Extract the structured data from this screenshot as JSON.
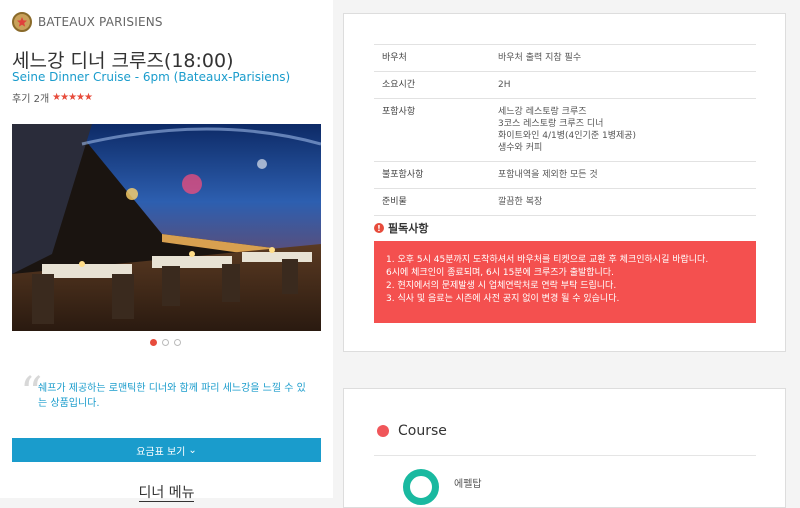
{
  "header": {
    "brand": "BATEAUX PARISIENS",
    "title": "세느강 디너 크루즈(18:00)",
    "subtitle": "Seine Dinner Cruise - 6pm (Bateaux-Parisiens)",
    "review_label": "후기 2개",
    "rating": 4.5,
    "stars": "★★★★★"
  },
  "gallery": {
    "slides": 3,
    "active_index": 0
  },
  "description": "쉐프가 제공하는 로맨틱한 디너와 함께 파리 세느강을 느낄 수 있는 상품입니다.",
  "price_button": {
    "label": "요금표 보기",
    "chevron": "⌄"
  },
  "menu_title": "디너 메뉴",
  "info": [
    {
      "label": "바우처",
      "value": "바우처 출력 지참 필수"
    },
    {
      "label": "소요시간",
      "value": "2H"
    },
    {
      "label": "포함사항",
      "value": "세느강 레스토랑 크루즈\n3코스 레스토랑 크루즈 디너\n화이트와인 4/1병(4인기준 1병제공)\n생수와 커피"
    },
    {
      "label": "불포함사항",
      "value": "포함내역을 제외한 모든 것"
    },
    {
      "label": "준비물",
      "value": "깔끔한 복장"
    }
  ],
  "notice": {
    "title": "필독사항",
    "icon": "!",
    "lines": [
      "1. 오후 5시 45분까지 도착하셔서 바우처를 티켓으로 교환 후 체크인하시길 바랍니다.",
      "6시에 체크인이 종료되며, 6시 15분에 크루즈가 출발합니다.",
      "2. 현지에서의 문제발생 시 업체연락처로 연락 부탁 드립니다.",
      "3. 식사 및 음료는 시즌에 사전 공지 없이 변경 될 수 있습니다."
    ]
  },
  "course": {
    "title": "Course",
    "stops": [
      "에펠탑"
    ]
  },
  "colors": {
    "accent_blue": "#1a9ccc",
    "notice_red": "#f4504f",
    "star_red": "#e74c3c",
    "course_dot": "#f0565a",
    "stop_ring": "#19b9a0"
  }
}
